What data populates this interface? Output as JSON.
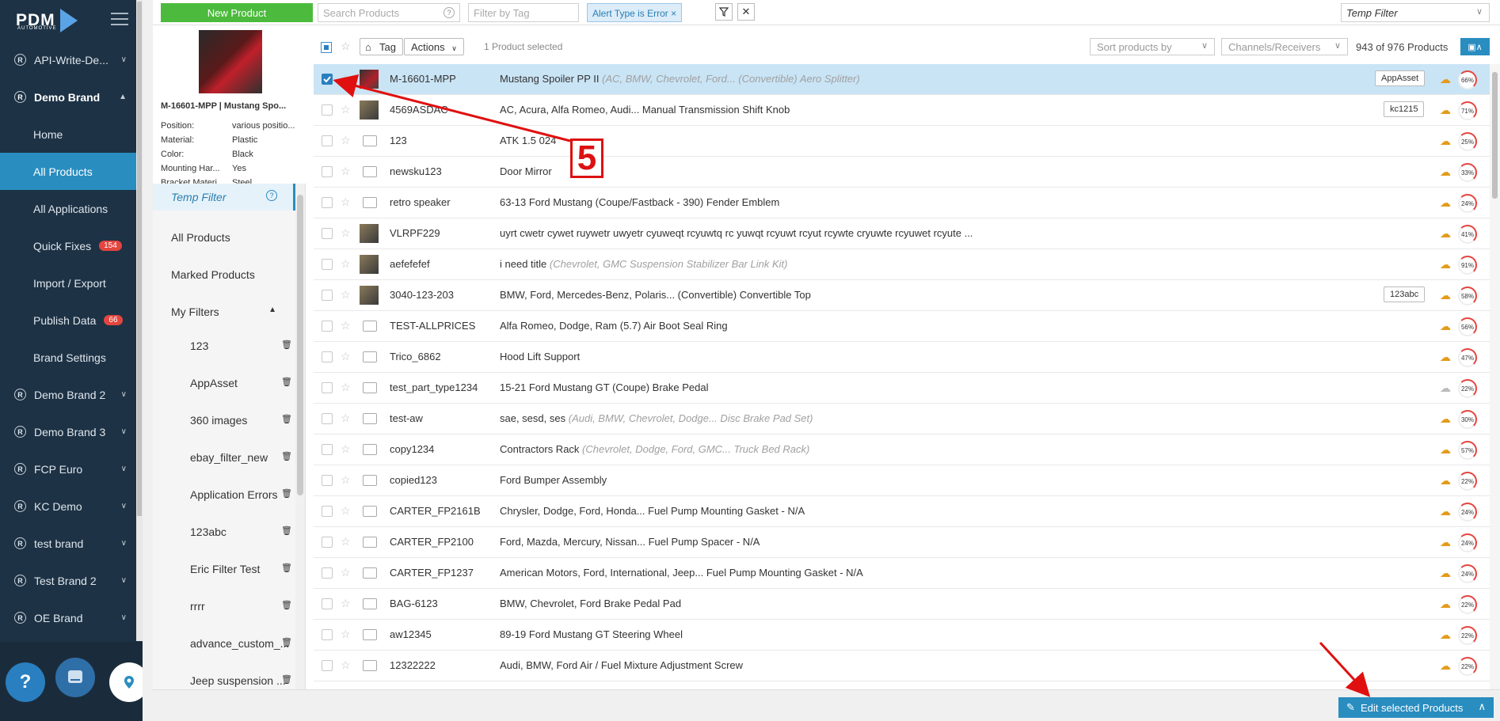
{
  "nav": {
    "logo": "PDM",
    "logo_sub": "AUTOMOTIVE",
    "items": [
      {
        "label": "API-Write-De...",
        "type": "brand"
      },
      {
        "label": "Demo Brand",
        "type": "brand-open"
      },
      {
        "label": "Home",
        "type": "sub"
      },
      {
        "label": "All Products",
        "type": "sub-active"
      },
      {
        "label": "All Applications",
        "type": "sub"
      },
      {
        "label": "Quick Fixes",
        "type": "sub",
        "badge": "154"
      },
      {
        "label": "Import / Export",
        "type": "sub"
      },
      {
        "label": "Publish Data",
        "type": "sub",
        "badge": "66"
      },
      {
        "label": "Brand Settings",
        "type": "sub"
      },
      {
        "label": "Demo Brand 2",
        "type": "brand"
      },
      {
        "label": "Demo Brand 3",
        "type": "brand"
      },
      {
        "label": "FCP Euro",
        "type": "brand"
      },
      {
        "label": "KC Demo",
        "type": "brand"
      },
      {
        "label": "test brand",
        "type": "brand"
      },
      {
        "label": "Test Brand 2",
        "type": "brand"
      },
      {
        "label": "OE Brand",
        "type": "brand"
      }
    ],
    "help": "?"
  },
  "toolbar": {
    "new_product": "New Product",
    "search_placeholder": "Search Products",
    "filter_tag_placeholder": "Filter by Tag",
    "alert_chip": "Alert Type is Error ×",
    "temp_filter": "Temp Filter"
  },
  "preview": {
    "title": "M-16601-MPP | Mustang Spo...",
    "attrs": [
      {
        "k": "Position:",
        "v": "various positio..."
      },
      {
        "k": "Material:",
        "v": "Plastic"
      },
      {
        "k": "Color:",
        "v": "Black"
      },
      {
        "k": "Mounting Har...",
        "v": "Yes"
      },
      {
        "k": "Bracket Materi...",
        "v": "Steel"
      }
    ]
  },
  "filters": {
    "temp": "Temp Filter",
    "all": "All Products",
    "marked": "Marked Products",
    "my_filters": "My Filters",
    "items": [
      "123",
      "AppAsset",
      "360 images",
      "ebay_filter_new",
      "Application Errors",
      "123abc",
      "Eric Filter Test",
      "rrrr",
      "advance_custom_...",
      "Jeep suspension ..."
    ]
  },
  "actions": {
    "tag": "Tag",
    "actions": "Actions",
    "selected": "1 Product selected",
    "sort": "Sort products by",
    "channels": "Channels/Receivers",
    "count": "943 of 976 Products"
  },
  "rows": [
    {
      "sku": "M-16601-MPP",
      "desc": "Mustang Spoiler PP II",
      "note": "(AC, BMW, Chevrolet, Ford... (Convertible) Aero Splitter)",
      "tag": "AppAsset",
      "pct": "66%",
      "selected": true,
      "img": "car",
      "cloud": "orange"
    },
    {
      "sku": "4569ASDAC",
      "desc": "AC, Acura, Alfa Romeo, Audi... Manual Transmission Shift Knob",
      "note": "",
      "tag": "kc1215",
      "pct": "71%",
      "selected": false,
      "img": "photo",
      "cloud": "orange"
    },
    {
      "sku": "123",
      "desc": "ATK 1.5 024",
      "note": "",
      "tag": "",
      "pct": "25%",
      "selected": false,
      "img": "ph",
      "cloud": "orange"
    },
    {
      "sku": "newsku123",
      "desc": "Door Mirror",
      "note": "",
      "tag": "",
      "pct": "33%",
      "selected": false,
      "img": "ph",
      "cloud": "orange"
    },
    {
      "sku": "retro speaker",
      "desc": "63-13 Ford Mustang (Coupe/Fastback - 390) Fender Emblem",
      "note": "",
      "tag": "",
      "pct": "24%",
      "selected": false,
      "img": "ph",
      "cloud": "orange"
    },
    {
      "sku": "VLRPF229",
      "desc": "uyrt cwetr cywet ruywetr uwyetr cyuweqt rcyuwtq rc yuwqt rcyuwt rcyut rcywte cryuwte rcyuwet rcyute ...",
      "note": "",
      "tag": "",
      "pct": "41%",
      "selected": false,
      "img": "photo",
      "cloud": "orange"
    },
    {
      "sku": "aefefefef",
      "desc": "i need title",
      "note": "(Chevrolet, GMC Suspension Stabilizer Bar Link Kit)",
      "tag": "",
      "pct": "91%",
      "selected": false,
      "img": "photo",
      "cloud": "orange"
    },
    {
      "sku": "3040-123-203",
      "desc": "BMW, Ford, Mercedes-Benz, Polaris... (Convertible) Convertible Top",
      "note": "",
      "tag": "123abc",
      "pct": "58%",
      "selected": false,
      "img": "photo",
      "cloud": "orange"
    },
    {
      "sku": "TEST-ALLPRICES",
      "desc": "Alfa Romeo, Dodge, Ram (5.7) Air Boot Seal Ring",
      "note": "",
      "tag": "",
      "pct": "56%",
      "selected": false,
      "img": "ph",
      "cloud": "orange"
    },
    {
      "sku": "Trico_6862",
      "desc": "Hood Lift Support",
      "note": "",
      "tag": "",
      "pct": "47%",
      "selected": false,
      "img": "ph",
      "cloud": "orange"
    },
    {
      "sku": "test_part_type1234",
      "desc": "15-21 Ford Mustang GT (Coupe) Brake Pedal",
      "note": "",
      "tag": "",
      "pct": "22%",
      "selected": false,
      "img": "ph",
      "cloud": "gray"
    },
    {
      "sku": "test-aw",
      "desc": "sae, sesd, ses",
      "note": "(Audi, BMW, Chevrolet, Dodge... Disc Brake Pad Set)",
      "tag": "",
      "pct": "30%",
      "selected": false,
      "img": "ph",
      "cloud": "orange"
    },
    {
      "sku": "copy1234",
      "desc": "Contractors Rack",
      "note": "(Chevrolet, Dodge, Ford, GMC... Truck Bed Rack)",
      "tag": "",
      "pct": "57%",
      "selected": false,
      "img": "ph",
      "cloud": "orange"
    },
    {
      "sku": "copied123",
      "desc": "Ford Bumper Assembly",
      "note": "",
      "tag": "",
      "pct": "22%",
      "selected": false,
      "img": "ph",
      "cloud": "orange"
    },
    {
      "sku": "CARTER_FP2161B",
      "desc": "Chrysler, Dodge, Ford, Honda... Fuel Pump Mounting Gasket - N/A",
      "note": "",
      "tag": "",
      "pct": "24%",
      "selected": false,
      "img": "ph",
      "cloud": "orange"
    },
    {
      "sku": "CARTER_FP2100",
      "desc": "Ford, Mazda, Mercury, Nissan... Fuel Pump Spacer - N/A",
      "note": "",
      "tag": "",
      "pct": "24%",
      "selected": false,
      "img": "ph",
      "cloud": "orange"
    },
    {
      "sku": "CARTER_FP1237",
      "desc": "American Motors, Ford, International, Jeep... Fuel Pump Mounting Gasket - N/A",
      "note": "",
      "tag": "",
      "pct": "24%",
      "selected": false,
      "img": "ph",
      "cloud": "orange"
    },
    {
      "sku": "BAG-6123",
      "desc": "BMW, Chevrolet, Ford Brake Pedal Pad",
      "note": "",
      "tag": "",
      "pct": "22%",
      "selected": false,
      "img": "ph",
      "cloud": "orange"
    },
    {
      "sku": "aw12345",
      "desc": "89-19 Ford Mustang GT Steering Wheel",
      "note": "",
      "tag": "",
      "pct": "22%",
      "selected": false,
      "img": "ph",
      "cloud": "orange"
    },
    {
      "sku": "12322222",
      "desc": "Audi, BMW, Ford Air / Fuel Mixture Adjustment Screw",
      "note": "",
      "tag": "",
      "pct": "22%",
      "selected": false,
      "img": "ph",
      "cloud": "orange"
    }
  ],
  "bottom": {
    "edit_selected": "Edit selected Products"
  },
  "annotation": {
    "step": "5"
  },
  "colors": {
    "nav_bg": "#1d3245",
    "accent": "#2a8dc0",
    "new_btn": "#4cbb3d",
    "badge": "#e3453f",
    "arrow": "#e01010"
  }
}
